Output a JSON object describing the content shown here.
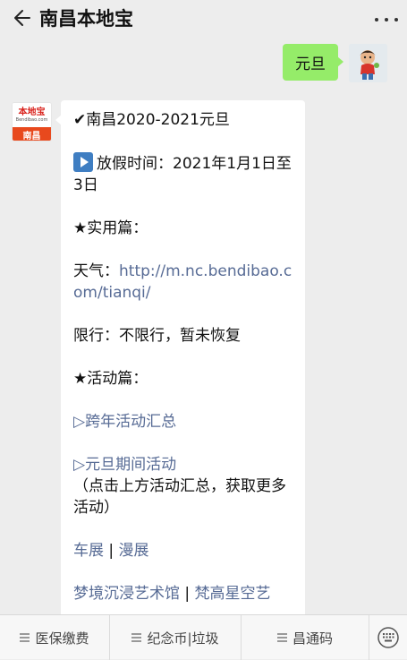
{
  "header": {
    "title": "南昌本地宝"
  },
  "messages": {
    "sent": {
      "text": "元旦"
    },
    "bot": {
      "avatar_logo_text": "本地宝",
      "avatar_logo_url": "Bendibao.com",
      "avatar_city": "南昌",
      "line1": "✔南昌2020-2021元旦",
      "holiday": "放假时间：2021年1月1日至3日",
      "practical_heading": "★实用篇：",
      "weather_label": "天气：",
      "weather_link": "http://m.nc.bendibao.com/tianqi/",
      "traffic": "限行：不限行，暂未恢复",
      "activity_heading": "★活动篇：",
      "link_newyear_eve": "▷跨年活动汇总",
      "link_newyear": "▷元旦期间活动",
      "click_tip": "（点击上方活动汇总，获取更多活动）",
      "link_car_show": "车展",
      "separator": " | ",
      "link_comic_show": "漫展",
      "link_dreamland": "梦境沉浸艺术馆",
      "link_vangogh": "梵高星空艺"
    }
  },
  "bottom_menu": {
    "items": [
      {
        "label": "医保缴费"
      },
      {
        "label": "纪念币|垃圾"
      },
      {
        "label": "昌通码"
      }
    ]
  },
  "colors": {
    "link": "#576b95",
    "sent_bubble": "#95ec69",
    "background": "#ededed"
  }
}
